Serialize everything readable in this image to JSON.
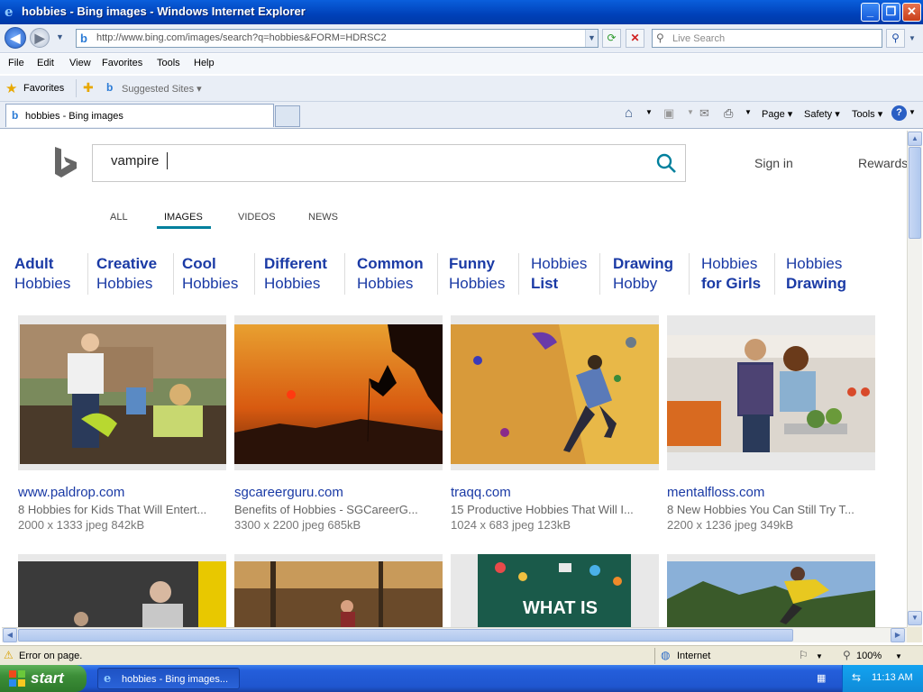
{
  "window": {
    "title": "hobbies - Bing images - Windows Internet Explorer"
  },
  "address": {
    "url": "http://www.bing.com/images/search?q=hobbies&FORM=HDRSC2"
  },
  "live_search": {
    "placeholder": "Live Search"
  },
  "menu": [
    "File",
    "Edit",
    "View",
    "Favorites",
    "Tools",
    "Help"
  ],
  "favorites_bar": {
    "favorites_label": "Favorites",
    "suggested_label": "Suggested Sites ▾"
  },
  "tab": {
    "label": "hobbies - Bing images"
  },
  "command_bar": {
    "page": "Page ▾",
    "safety": "Safety ▾",
    "tools": "Tools ▾"
  },
  "bing": {
    "search_value": "vampire",
    "sign_in": "Sign in",
    "rewards": "Rewards",
    "nav": [
      "ALL",
      "IMAGES",
      "VIDEOS",
      "NEWS"
    ],
    "related": [
      {
        "top": "Adult",
        "bottom": "Hobbies",
        "bold": "top"
      },
      {
        "top": "Creative",
        "bottom": "Hobbies",
        "bold": "top"
      },
      {
        "top": "Cool",
        "bottom": "Hobbies",
        "bold": "top"
      },
      {
        "top": "Different",
        "bottom": "Hobbies",
        "bold": "top"
      },
      {
        "top": "Common",
        "bottom": "Hobbies",
        "bold": "top"
      },
      {
        "top": "Funny",
        "bottom": "Hobbies",
        "bold": "top"
      },
      {
        "top": "Hobbies",
        "bottom": "List",
        "bold": "bottom"
      },
      {
        "top": "Drawing",
        "bottom": "Hobby",
        "bold": "top"
      },
      {
        "top": "Hobbies",
        "bottom": "for Girls",
        "bold": "bottom"
      },
      {
        "top": "Hobbies",
        "bottom": "Drawing",
        "bold": "bottom"
      }
    ],
    "results": [
      {
        "domain": "www.paldrop.com",
        "desc": "8 Hobbies for Kids That Will Entert...",
        "meta": "2000 x 1333 jpeg 842kB"
      },
      {
        "domain": "sgcareerguru.com",
        "desc": "Benefits of Hobbies - SGCareerG...",
        "meta": "3300 x 2200 jpeg 685kB"
      },
      {
        "domain": "traqq.com",
        "desc": "15 Productive Hobbies That Will I...",
        "meta": "1024 x 683 jpeg 123kB"
      },
      {
        "domain": "mentalfloss.com",
        "desc": "8 New Hobbies You Can Still Try T...",
        "meta": "2200 x 1236 jpeg 349kB"
      }
    ],
    "row2_image_text": "WHAT IS"
  },
  "status": {
    "left": "Error on page.",
    "zone": "Internet",
    "zoom": "100%"
  },
  "taskbar": {
    "start": "start",
    "item": "hobbies - Bing images...",
    "clock": "11:13 AM"
  },
  "colors": {
    "link": "#1a3aa5",
    "bing_accent": "#00809d"
  }
}
